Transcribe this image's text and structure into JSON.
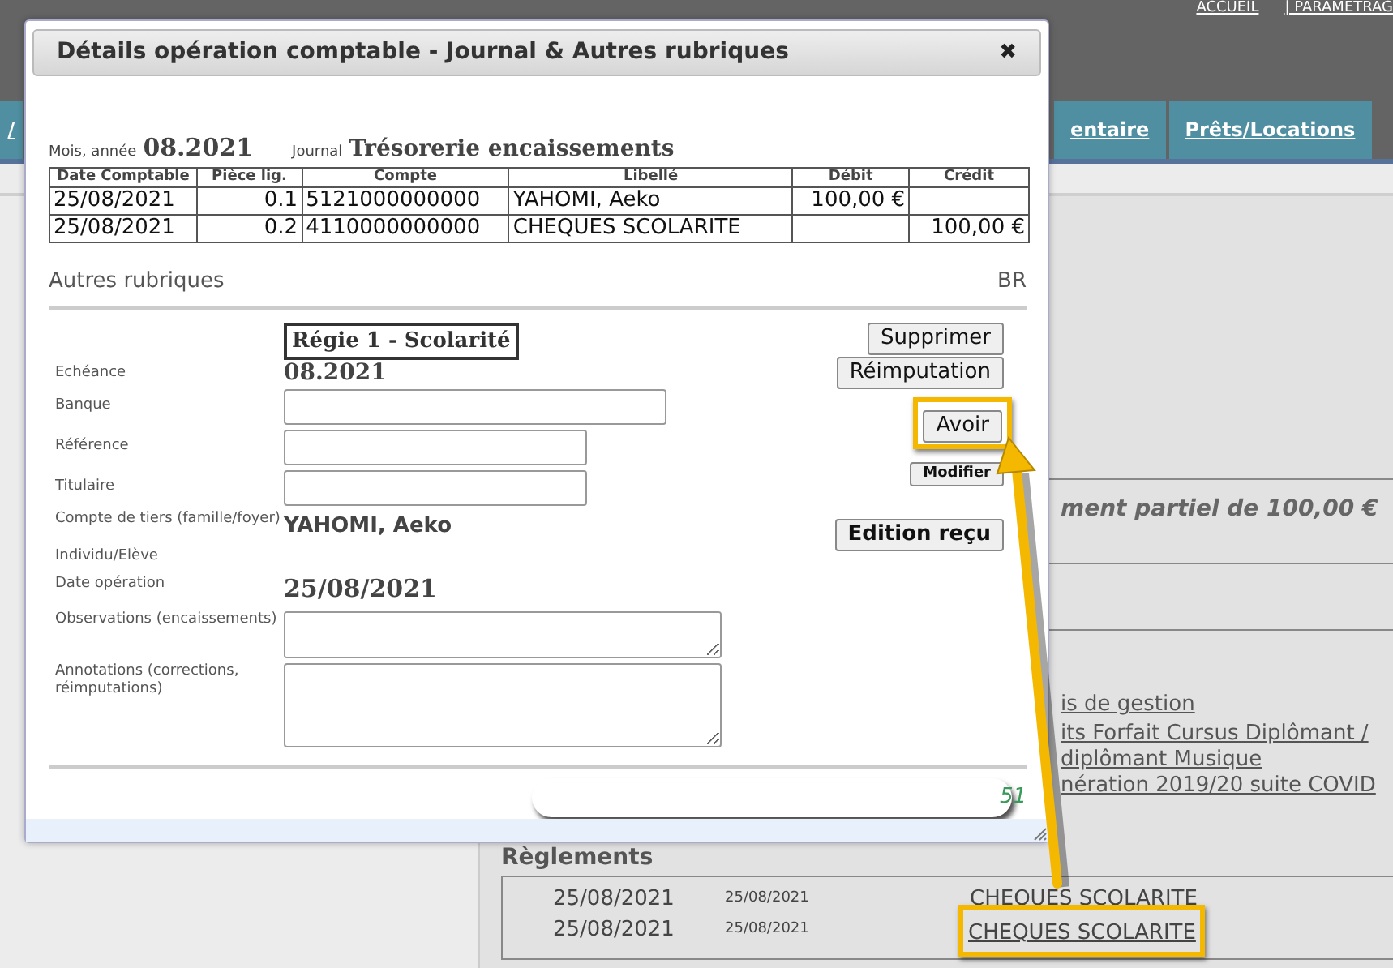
{
  "header": {
    "links": [
      "ACCUEIL",
      "| PARAMETRAG"
    ]
  },
  "tabs": [
    {
      "label": "/"
    },
    {
      "label": "entaire"
    },
    {
      "label": "Prêts/Locations"
    }
  ],
  "background": {
    "note": "ment partiel de 100,00 €",
    "links": [
      "is de gestion",
      "its Forfait Cursus Diplômant /",
      "diplômant Musique",
      "nération 2019/20 suite COVID"
    ],
    "payments": {
      "title": "Règlements",
      "rows": [
        {
          "date": "25/08/2021",
          "date_2": "25/08/2021",
          "label": "CHEQUES SCOLARITE",
          "highlighted": false
        },
        {
          "date": "25/08/2021",
          "date_2": "25/08/2021",
          "label": "CHEQUES SCOLARITE",
          "highlighted": true
        }
      ]
    }
  },
  "modal": {
    "title": "Détails opération comptable - Journal & Autres rubriques",
    "close": "✖",
    "period_label": "Mois, année",
    "period": "08.2021",
    "journal_label": "Journal",
    "journal": "Trésorerie encaissements",
    "table": {
      "columns": [
        "Date Comptable",
        "Pièce lig.",
        "Compte",
        "Libellé",
        "Débit",
        "Crédit"
      ],
      "rows": [
        [
          "25/08/2021",
          "0.1",
          "5121000000000",
          "YAHOMI, Aeko",
          "100,00 €",
          ""
        ],
        [
          "25/08/2021",
          "0.2",
          "4110000000000",
          "CHEQUES SCOLARITE",
          "",
          "100,00 €"
        ]
      ]
    },
    "section": {
      "title": "Autres rubriques",
      "code": "BR"
    },
    "regie": "Régie 1 - Scolarité",
    "fields": [
      {
        "label": "Echéance",
        "kind": "period",
        "value": "08.2021"
      },
      {
        "label": "Banque",
        "kind": "longinput"
      },
      {
        "label": "Référence",
        "kind": "input"
      },
      {
        "label": "Titulaire",
        "kind": "input"
      },
      {
        "label": "Compte de tiers (famille/foyer)",
        "kind": "name",
        "value": "YAHOMI, Aeko"
      },
      {
        "label": "Individu/Elève",
        "kind": "none"
      },
      {
        "label": "Date opération",
        "kind": "date",
        "value": "25/08/2021"
      },
      {
        "label": "Observations (encaissements)",
        "kind": "textarea"
      },
      {
        "label": "Annotations (corrections, réimputations)",
        "kind": "bigtextarea"
      }
    ],
    "buttons": [
      {
        "label": "Supprimer",
        "kind": "normal",
        "highlighted": false
      },
      {
        "label": "Réimputation",
        "kind": "normal",
        "highlighted": false
      },
      {
        "label": "Avoir",
        "kind": "normal",
        "highlighted": true
      },
      {
        "label": "Modifier",
        "kind": "small",
        "highlighted": false
      },
      {
        "label": "Edition reçu",
        "kind": "bold",
        "highlighted": false
      }
    ],
    "footer_number": "51"
  }
}
